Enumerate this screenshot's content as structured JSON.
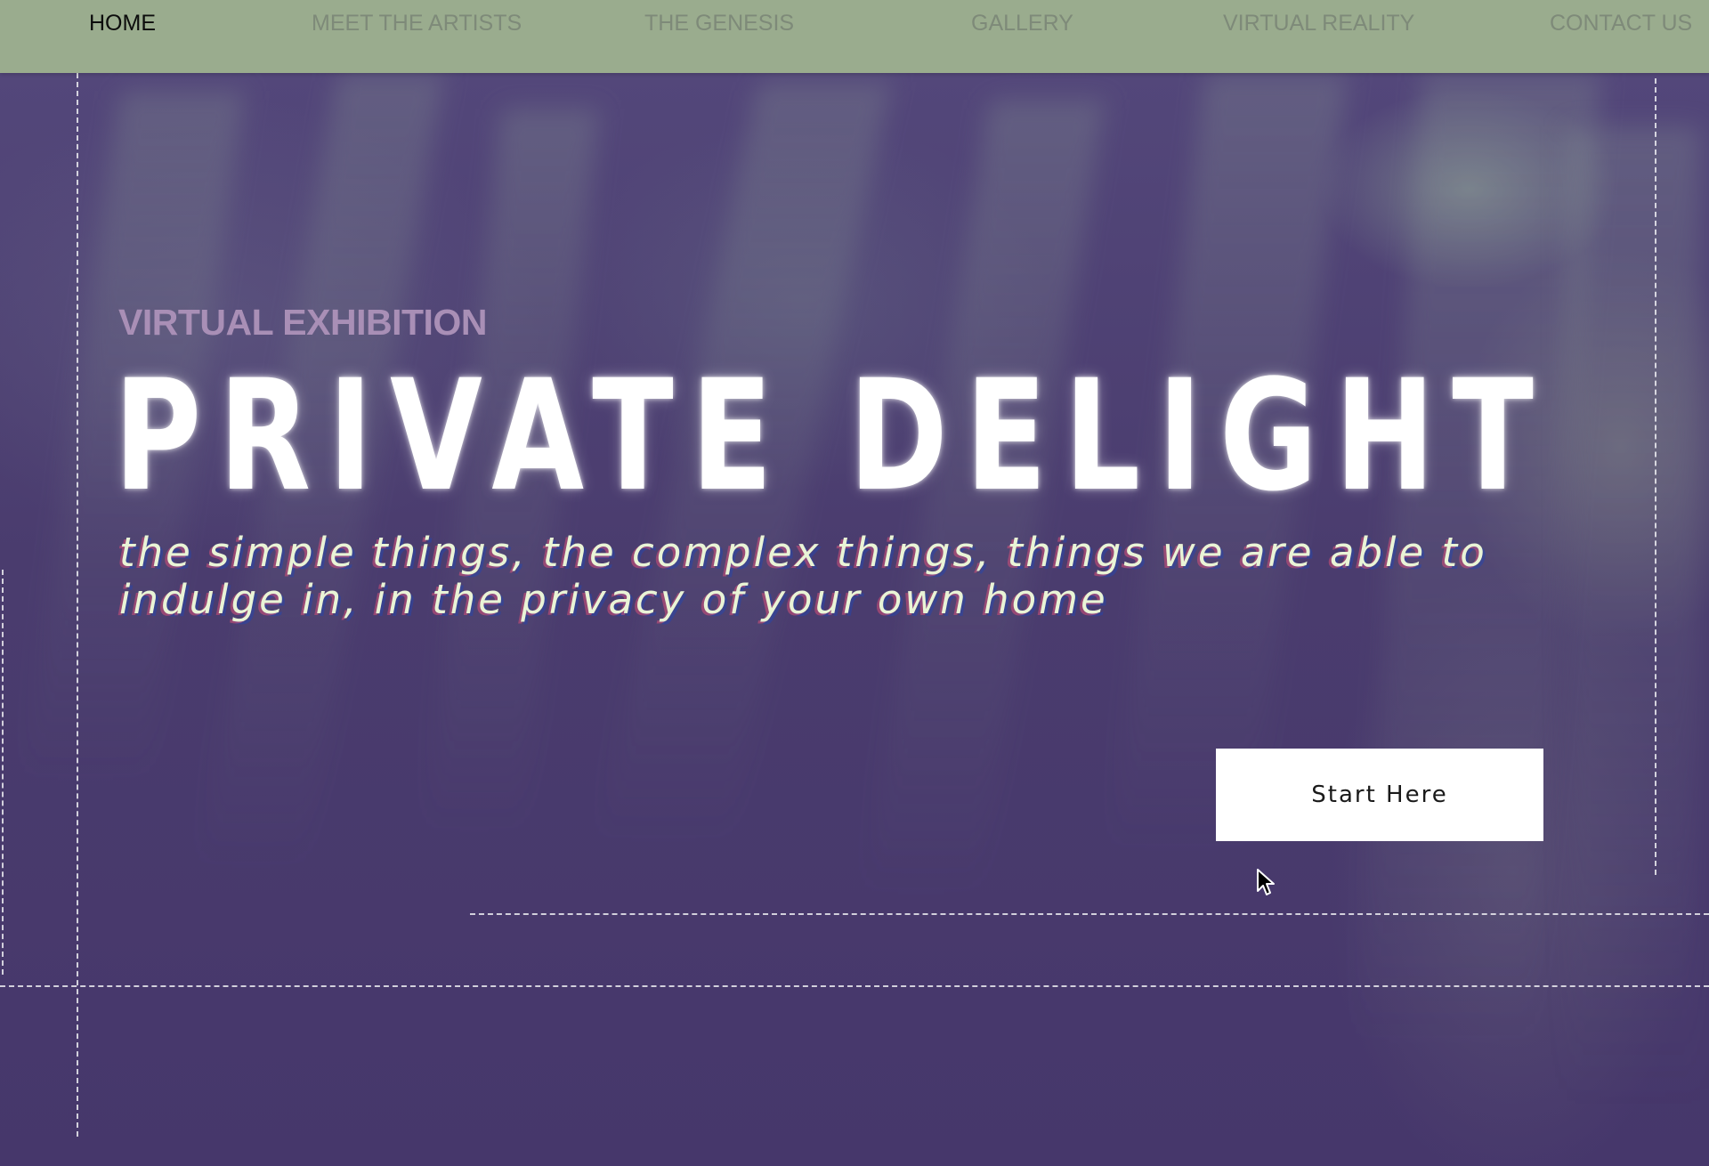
{
  "nav": {
    "items": [
      {
        "label": "HOME",
        "active": true
      },
      {
        "label": "MEET THE ARTISTS",
        "active": false
      },
      {
        "label": "THE GENESIS",
        "active": false
      },
      {
        "label": "GALLERY",
        "active": false
      },
      {
        "label": "VIRTUAL REALITY",
        "active": false
      },
      {
        "label": "CONTACT US",
        "active": false
      }
    ]
  },
  "hero": {
    "eyebrow": "VIRTUAL EXHIBITION",
    "title": "PRIVATE DELIGHT",
    "tagline": "the simple things, the complex things, things we are able to indulge in, in the privacy of your own home",
    "cta_label": "Start Here"
  },
  "colors": {
    "nav_bg": "#9aac8e",
    "nav_text": "#7e8a79",
    "nav_active": "#0c0c0c",
    "hero_bg": "#4a3c6e",
    "eyebrow": "#a98fb6",
    "title": "#ffffff",
    "tagline": "#e9f4d6",
    "button_bg": "#ffffff"
  },
  "icons": {
    "cursor": "arrow-cursor-icon"
  }
}
